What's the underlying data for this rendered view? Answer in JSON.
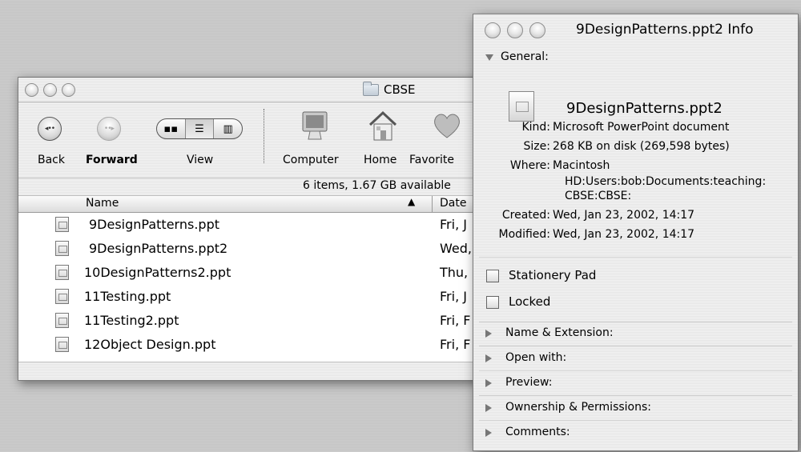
{
  "finder": {
    "title": "CBSE",
    "toolbar": {
      "back": "Back",
      "forward": "Forward",
      "view": "View",
      "computer": "Computer",
      "home": "Home",
      "favorites": "Favorite"
    },
    "status": "6 items, 1.67 GB available",
    "columns": {
      "name": "Name",
      "date": "Date"
    },
    "files": [
      {
        "name": "9DesignPatterns.ppt",
        "date": "Fri, J"
      },
      {
        "name": "9DesignPatterns.ppt2",
        "date": "Wed,"
      },
      {
        "name": "10DesignPatterns2.ppt",
        "date": "Thu,"
      },
      {
        "name": "11Testing.ppt",
        "date": "Fri, J"
      },
      {
        "name": "11Testing2.ppt",
        "date": "Fri, F"
      },
      {
        "name": "12Object Design.ppt",
        "date": "Fri, F"
      }
    ]
  },
  "info": {
    "title": "9DesignPatterns.ppt2 Info",
    "general_label": "General:",
    "doc_name": "9DesignPatterns.ppt2",
    "fields": {
      "kind_label": "Kind:",
      "kind": "Microsoft PowerPoint document",
      "size_label": "Size:",
      "size": "268 KB on disk (269,598 bytes)",
      "where_label": "Where:",
      "where_line1": "Macintosh",
      "where_line2": "HD:Users:bob:Documents:teaching:",
      "where_line3": "CBSE:CBSE:",
      "created_label": "Created:",
      "created": "Wed, Jan 23, 2002, 14:17",
      "modified_label": "Modified:",
      "modified": "Wed, Jan 23, 2002, 14:17"
    },
    "stationery_pad": "Stationery Pad",
    "locked": "Locked",
    "sections": {
      "name_ext": "Name & Extension:",
      "open_with": "Open with:",
      "preview": "Preview:",
      "ownership": "Ownership & Permissions:",
      "comments": "Comments:"
    }
  }
}
